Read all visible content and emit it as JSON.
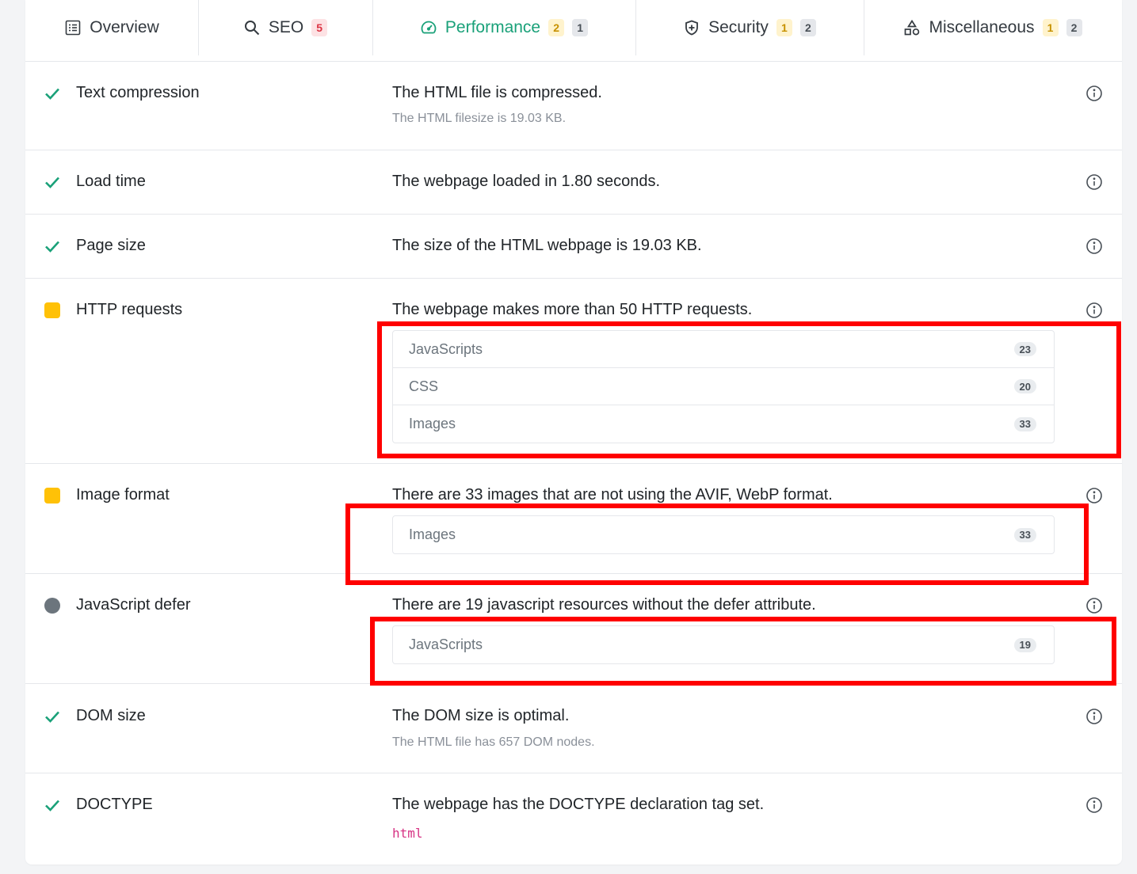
{
  "tabs": [
    {
      "label": "Overview",
      "icon": "list-icon",
      "badges": []
    },
    {
      "label": "SEO",
      "icon": "search-icon",
      "badges": [
        {
          "value": "5",
          "color": "red"
        }
      ]
    },
    {
      "label": "Performance",
      "icon": "gauge-icon",
      "active": true,
      "badges": [
        {
          "value": "2",
          "color": "yellow"
        },
        {
          "value": "1",
          "color": "gray"
        }
      ]
    },
    {
      "label": "Security",
      "icon": "shield-icon",
      "badges": [
        {
          "value": "1",
          "color": "yellow"
        },
        {
          "value": "2",
          "color": "gray"
        }
      ]
    },
    {
      "label": "Miscellaneous",
      "icon": "shapes-icon",
      "badges": [
        {
          "value": "1",
          "color": "yellow"
        },
        {
          "value": "2",
          "color": "gray"
        }
      ]
    }
  ],
  "colors": {
    "accent": "#1aa179",
    "pass": "#1aa179",
    "warning": "#ffc107",
    "neutral": "#6c757d",
    "highlight": "#ff0000"
  },
  "rows": [
    {
      "status": "pass",
      "title": "Text compression",
      "message": "The HTML file is compressed.",
      "detail": "The HTML filesize is 19.03 KB."
    },
    {
      "status": "pass",
      "title": "Load time",
      "message": "The webpage loaded in 1.80 seconds."
    },
    {
      "status": "pass",
      "title": "Page size",
      "message": "The size of the HTML webpage is 19.03 KB."
    },
    {
      "status": "warning",
      "title": "HTTP requests",
      "message": "The webpage makes more than 50 HTTP requests.",
      "items": [
        {
          "label": "JavaScripts",
          "count": "23"
        },
        {
          "label": "CSS",
          "count": "20"
        },
        {
          "label": "Images",
          "count": "33"
        }
      ]
    },
    {
      "status": "warning",
      "title": "Image format",
      "message": "There are 33 images that are not using the AVIF, WebP format.",
      "items": [
        {
          "label": "Images",
          "count": "33"
        }
      ]
    },
    {
      "status": "neutral",
      "title": "JavaScript defer",
      "message": "There are 19 javascript resources without the defer attribute.",
      "items": [
        {
          "label": "JavaScripts",
          "count": "19"
        }
      ]
    },
    {
      "status": "pass",
      "title": "DOM size",
      "message": "The DOM size is optimal.",
      "detail": "The HTML file has 657 DOM nodes."
    },
    {
      "status": "pass",
      "title": "DOCTYPE",
      "message": "The webpage has the DOCTYPE declaration tag set.",
      "code": "html"
    }
  ]
}
